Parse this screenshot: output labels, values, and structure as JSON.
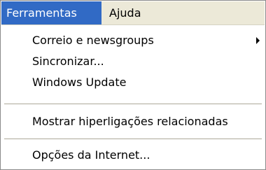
{
  "menubar": {
    "items": [
      {
        "label": "Ferramentas",
        "state": "open"
      },
      {
        "label": "Ajuda"
      }
    ]
  },
  "menu": {
    "items": [
      {
        "label": "Correio e newsgroups",
        "has_submenu": true
      },
      {
        "label": "Sincronizar..."
      },
      {
        "label": "Windows Update"
      },
      {
        "label": "Mostrar hiperligações relacionadas"
      },
      {
        "label": "Opções da Internet..."
      }
    ]
  },
  "colors": {
    "menubar_background": "#ece9d8",
    "highlight": "#316ac5",
    "highlight_text": "#ffffff",
    "menu_background": "#ffffff",
    "separator": "#aca899"
  }
}
